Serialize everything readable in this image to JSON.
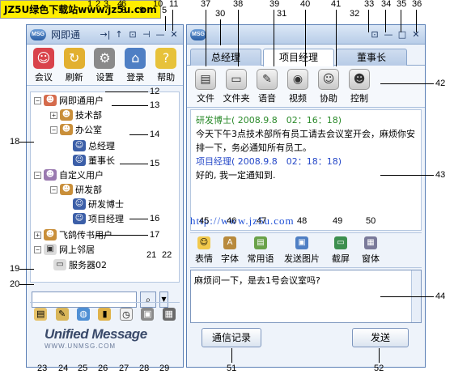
{
  "watermark": "JZ5U绿色下载站www.jz5u.com",
  "url_watermark": "http://www.jz5u.com",
  "left_window": {
    "logo": "MSG",
    "title": "网即通",
    "controls": [
      "→|",
      "↑",
      "⊡",
      "⊣",
      "—",
      "✕"
    ],
    "toolbar": [
      {
        "label": "会议",
        "icon": "meeting-icon",
        "color": "#d9434b",
        "glyph": "☺"
      },
      {
        "label": "刷新",
        "icon": "refresh-icon",
        "color": "#e2b030",
        "glyph": "↻"
      },
      {
        "label": "设置",
        "icon": "settings-icon",
        "color": "#8a8a8a",
        "glyph": "⚙"
      },
      {
        "label": "登录",
        "icon": "login-icon",
        "color": "#4f7fc4",
        "glyph": "⌂"
      },
      {
        "label": "帮助",
        "icon": "help-icon",
        "color": "#e7c23a",
        "glyph": "?"
      }
    ],
    "tree": {
      "root": "网即通用户",
      "tech": "技术部",
      "office": "办公室",
      "gm": "总经理",
      "chairman": "董事长",
      "custom": "自定义用户",
      "rnd": "研发部",
      "doctor": "研发博士",
      "pm": "项目经理",
      "fax": "飞鸽传书用户",
      "neighbors": "网上邻居",
      "server": "服务器02"
    },
    "search_value": "",
    "bottom_icons": [
      "clipboard-icon",
      "notes-icon",
      "globe-icon",
      "book-icon",
      "clock-icon",
      "save-icon",
      "calculator-icon"
    ],
    "brand": "Unified Message",
    "brand_url": "WWW.UNMSG.COM"
  },
  "right_window": {
    "logo": "MSG",
    "controls": [
      "⊡",
      "—",
      "□",
      "✕"
    ],
    "tabs": [
      {
        "label": "总经理",
        "active": false
      },
      {
        "label": "项目经理",
        "active": true
      },
      {
        "label": "董事长",
        "active": false
      }
    ],
    "toolbar": [
      {
        "label": "文件",
        "icon": "file-icon",
        "glyph": "▤"
      },
      {
        "label": "文件夹",
        "icon": "folder-icon",
        "glyph": "▭"
      },
      {
        "label": "语音",
        "icon": "microphone-icon",
        "glyph": "✎"
      },
      {
        "label": "视频",
        "icon": "webcam-icon",
        "glyph": "◉"
      },
      {
        "label": "协助",
        "icon": "assist-icon",
        "glyph": "☺"
      },
      {
        "label": "控制",
        "icon": "control-icon",
        "glyph": "☻"
      }
    ],
    "messages": [
      {
        "sender": "研发博士",
        "time": "( 2008.9.8　02：16：18)",
        "text": "今天下午3点技术部所有员工请去会议室开会，麻烦你安排一下，务必通知所有员工。",
        "me": false
      },
      {
        "sender": "项目经理",
        "time": "( 2008.9.8　02：18：18)",
        "text": "好的, 我一定通知到.",
        "me": true
      }
    ],
    "chat_toolbar": [
      {
        "label": "表情",
        "icon": "emoticon-icon",
        "color": "#f2c94c"
      },
      {
        "label": "字体",
        "icon": "font-icon",
        "color": "#b88a3d"
      },
      {
        "label": "常用语",
        "icon": "phrases-icon",
        "color": "#6aa24a"
      },
      {
        "label": "发送图片",
        "icon": "send-image-icon",
        "color": "#4f7fc4"
      },
      {
        "label": "截屏",
        "icon": "screenshot-icon",
        "color": "#3d8f4f"
      },
      {
        "label": "窗体",
        "icon": "window-icon",
        "color": "#7a7a9a"
      }
    ],
    "compose_text": "麻烦问一下，是去1号会议室吗?",
    "history_button": "通信记录",
    "send_button": "发送"
  },
  "callouts": [
    "1",
    "2",
    "3",
    "4",
    "5",
    "6",
    "7",
    "8",
    "9",
    "10",
    "11",
    "12",
    "13",
    "14",
    "15",
    "16",
    "17",
    "18",
    "19",
    "20",
    "21",
    "22",
    "23",
    "24",
    "25",
    "26",
    "27",
    "28",
    "29",
    "30",
    "31",
    "32",
    "33",
    "34",
    "35",
    "36",
    "37",
    "38",
    "39",
    "40",
    "41",
    "42",
    "43",
    "44",
    "45",
    "46",
    "47",
    "48",
    "49",
    "50",
    "51",
    "52"
  ]
}
